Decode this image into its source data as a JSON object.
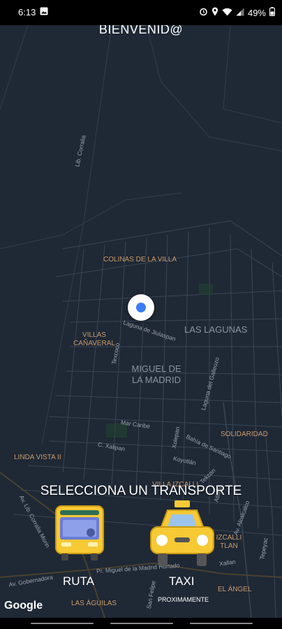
{
  "status": {
    "time": "6:13",
    "battery": "49%"
  },
  "header": {
    "title": "BIENVENID@"
  },
  "map": {
    "places": {
      "colinas": "COLINAS DE LA VILLA",
      "villas": "VILLAS CAÑAVERAL",
      "lagunas": "LAS LAGUNAS",
      "miguel": "MIGUEL DE LA MADRID",
      "solidaridad": "SOLIDARIDAD",
      "linda": "LINDA VISTA II",
      "izcalli": "IZCALLI TLAN",
      "angel": "EL ÁNGEL",
      "aguilas": "LAS ÁGUILAS",
      "proximamente": "PROXIMAMENTE",
      "villa_izcalli": "VILLA IZCALLI"
    },
    "streets": {
      "corralia": "Lib. Corralia",
      "jiulaspan": "Laguna de Jiulaspan",
      "texcoco": "Texcoco",
      "galleoso": "Laguna del Galleozo",
      "mar_caribe": "Mar Caribe",
      "xalipan": "C. Xalipan",
      "bahia": "Bahía de Santiago",
      "koyotlan": "Koyotlán",
      "xolepan": "Xolepan",
      "gobernadora": "Av. Gobernadora",
      "lib_corralia_morin": "Av. Lib. Corralia Morin",
      "pr_miguel": "Pr. Miguel de la Madrid Hurtado",
      "san_felipe": "San Felipe",
      "acalcalco": "Av. Alcalcalco",
      "tepeyac": "Tepeyac",
      "xallan": "Xallan",
      "atlixco": "Atlixco",
      "texcoco2": "Tekcan"
    },
    "attribution": "Google"
  },
  "overlay": {
    "select_title": "SELECCIONA UN TRANSPORTE",
    "route_label": "RUTA",
    "taxi_label": "TAXI"
  },
  "colors": {
    "map_bg": "#1f2835",
    "road": "#3a4656",
    "place_label": "#c89b6a",
    "bus": "#f7c935",
    "taxi": "#f7c935"
  },
  "icons": [
    "image-icon",
    "alarm-icon",
    "location-icon",
    "wifi-icon",
    "signal-icon",
    "battery-icon",
    "bus-icon",
    "taxi-icon",
    "location-dot"
  ]
}
